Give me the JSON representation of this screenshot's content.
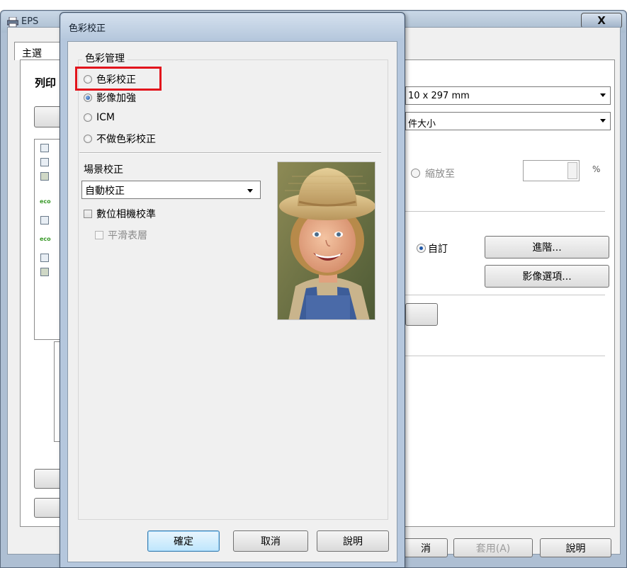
{
  "background_window": {
    "title": "EPS",
    "close_label": "X",
    "tab_main": "主選",
    "label_print": "列印",
    "paper_size": "10 x 297 mm",
    "paper_output": "件大小",
    "scale_option": "縮放至",
    "percent_symbol": "%",
    "custom_option": "自訂",
    "advanced_button": "進階...",
    "image_options_button": "影像選項...",
    "footer": {
      "cancel_label": "消",
      "apply_label": "套用(A)",
      "help_label": "說明"
    },
    "side_icons": [
      "doc-icon",
      "doc-icon",
      "photo-icon",
      "eco-icon",
      "numbered-pages-icon",
      "eco-icon",
      "doc-icon",
      "photo-icon"
    ]
  },
  "dialog": {
    "title": "色彩校正",
    "color_management": {
      "group_label": "色彩管理",
      "options": [
        {
          "label": "色彩校正",
          "selected": false,
          "highlighted": true
        },
        {
          "label": "影像加強",
          "selected": true
        },
        {
          "label": "ICM",
          "selected": false
        },
        {
          "label": "不做色彩校正",
          "selected": false
        }
      ]
    },
    "scene": {
      "label": "場景校正",
      "selected_value": "自動校正"
    },
    "digital_camera_calibration": {
      "label": "數位相機校準",
      "checked": false
    },
    "smooth_surface": {
      "label": "平滑表層",
      "checked": false,
      "disabled": true
    },
    "preview_image": "child-with-straw-hat-photo",
    "buttons": {
      "ok": "確定",
      "cancel": "取消",
      "help": "說明"
    }
  },
  "colors": {
    "highlight_border": "#e2141c",
    "selected_radio": "#1b4f9b",
    "default_button_border": "#3c7fb1"
  }
}
